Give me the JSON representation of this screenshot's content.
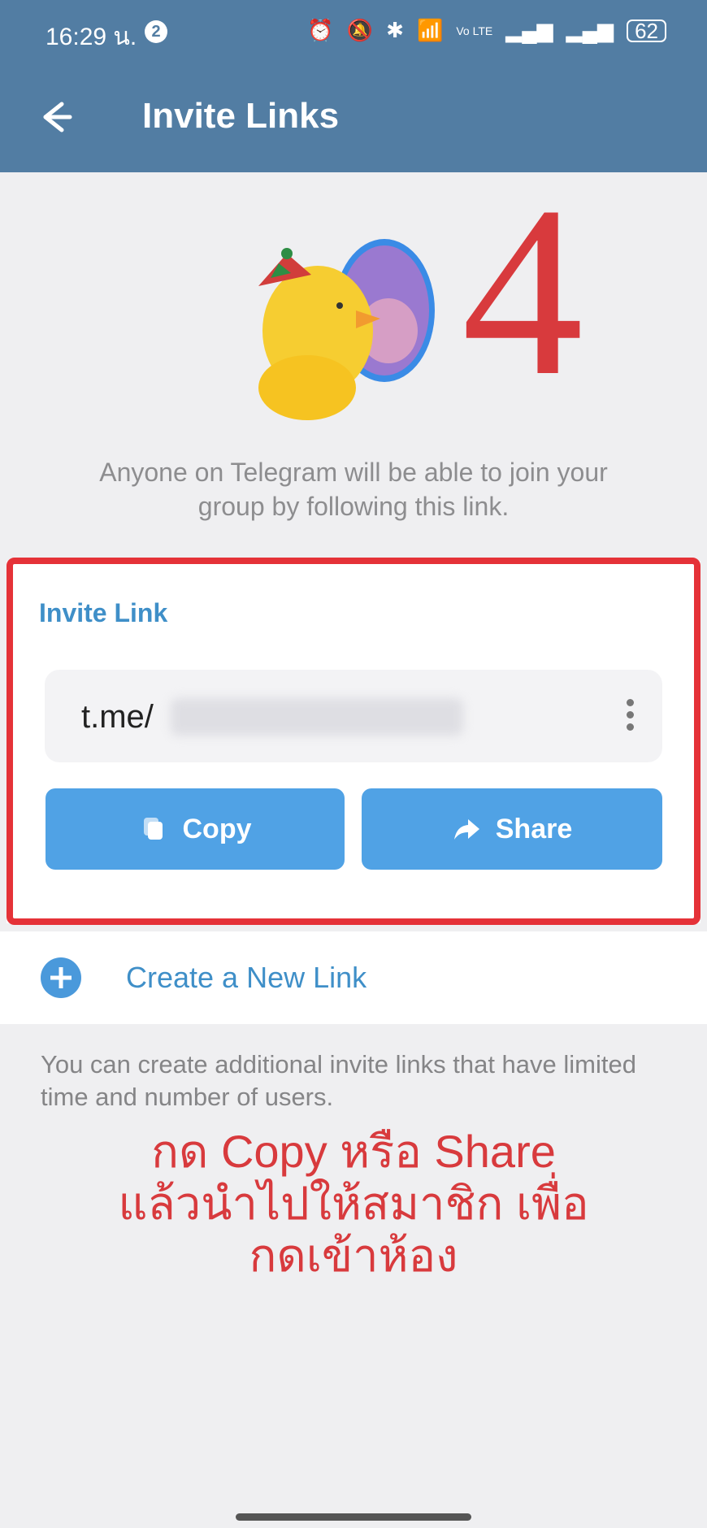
{
  "status_bar": {
    "time": "16:29 น.",
    "notification_count": "2",
    "network_label": "Vo LTE",
    "battery": "62",
    "icons": [
      "alarm-icon",
      "mute-icon",
      "bluetooth-icon",
      "wifi-icon",
      "signal-icon",
      "signal-icon",
      "battery-icon"
    ]
  },
  "header": {
    "title": "Invite Links",
    "back_icon": "back-arrow-icon"
  },
  "sticker": {
    "name": "duck-party-sticker",
    "annotation_number": "4"
  },
  "helper_text": "Anyone on Telegram will be able to join your group by following this link.",
  "invite_card": {
    "title": "Invite Link",
    "link_prefix": "t.me/",
    "menu_icon": "more-vertical-icon",
    "copy_label": "Copy",
    "share_label": "Share"
  },
  "create_link": {
    "label": "Create a New Link",
    "icon": "add-circle-icon"
  },
  "footer_note": "You can create additional invite links that have limited time and number of users.",
  "annotation": {
    "line1": "กด Copy หรือ Share",
    "line2": "แล้วนำไปให้สมาชิก เพื่อ",
    "line3": "กดเข้าห้อง"
  },
  "colors": {
    "header": "#527da3",
    "accent": "#50a2e5",
    "highlight": "#e53238"
  }
}
